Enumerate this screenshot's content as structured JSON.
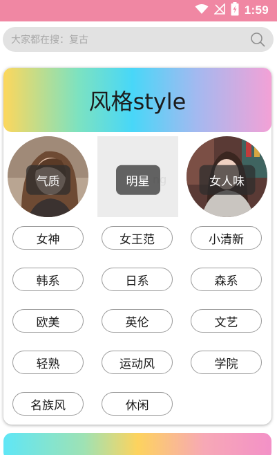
{
  "status_bar": {
    "time": "1:59"
  },
  "search": {
    "placeholder": "大家都在搜：复古"
  },
  "style_card": {
    "title": "风格style",
    "features": [
      {
        "label": "气质"
      },
      {
        "label": "明星"
      },
      {
        "label": "女人味"
      }
    ],
    "tags": [
      "女神",
      "女王范",
      "小清新",
      "韩系",
      "日系",
      "森系",
      "欧美",
      "英伦",
      "文艺",
      "轻熟",
      "运动风",
      "学院",
      "名族风",
      "休闲"
    ]
  },
  "colors": {
    "status_bar": "#f087a3",
    "search_bg": "#e2e2e2",
    "tag_border": "#9a9a9a"
  }
}
